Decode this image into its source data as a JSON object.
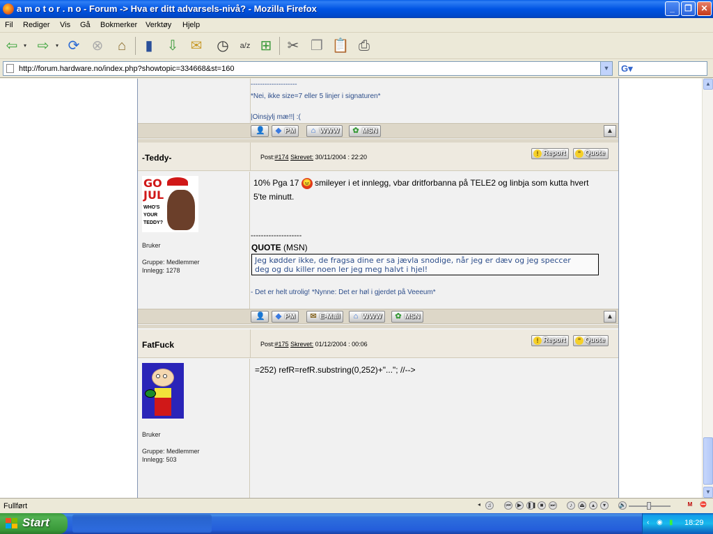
{
  "window": {
    "title": "a m o t o r . n o - Forum -> Hva er ditt advarsels-nivå? - Mozilla Firefox"
  },
  "menu": [
    "Fil",
    "Rediger",
    "Vis",
    "Gå",
    "Bokmerker",
    "Verktøy",
    "Hjelp"
  ],
  "toolbar_icons": [
    "back-icon",
    "back-dropdown-icon",
    "forward-icon",
    "forward-dropdown-icon",
    "reload-icon",
    "stop-icon",
    "home-icon",
    "bookmarks-icon",
    "download-icon",
    "mail-icon",
    "history-icon",
    "translate-icon",
    "new-tab-icon",
    "cut-icon",
    "copy-icon",
    "paste-icon",
    "print-icon"
  ],
  "address": {
    "url": "http://forum.hardware.no/index.php?showtopic=334668&st=160"
  },
  "search": {
    "engine_icon": "google-icon",
    "value": ""
  },
  "prev_post": {
    "sig_divider": "--------------------",
    "sig_line1": "*Nei, ikke size=7 eller 5 linjer i signaturen*",
    "sig_line2": "|Oinsjylj mæ!!| :(",
    "buttons": {
      "pm": "PM",
      "www": "WWW",
      "msn": "MSN"
    }
  },
  "posts": [
    {
      "author": "-Teddy-",
      "post_label": "Post:",
      "post_num": "#174",
      "written_label": "Skrevet:",
      "date": "30/11/2004 : 22:20",
      "report": "Report",
      "quote": "Quote",
      "avatar_text": [
        "GO",
        "JUL",
        "WHO'S",
        "YOUR",
        "TEDDY?"
      ],
      "rank": "Bruker",
      "group": "Gruppe: Medlemmer",
      "posts_count": "Innlegg: 1278",
      "text_before": "10% Pga 17",
      "text_after": "smileyer i et innlegg, vbar dritforbanna på TELE2 og linbja som kutta hvert",
      "text_line2": "5'te minutt.",
      "sig_divider": "--------------------",
      "quote_label": "QUOTE",
      "quote_source": "(MSN)",
      "quote_text1": "Jeg kødder ikke, de fragsa dine er sa jævla snodige, når jeg er dæv og jeg speccer",
      "quote_text2": "deg og du killer noen ler jeg meg halvt i hjel!",
      "sig_line": "- Det er helt utrolig! *Nynne: Det er høl i gjerdet på Veeeum*",
      "buttons": {
        "pm": "PM",
        "email": "E-Mail",
        "www": "WWW",
        "msn": "MSN"
      }
    },
    {
      "author": "FatFuck",
      "post_label": "Post:",
      "post_num": "#175",
      "written_label": "Skrevet:",
      "date": "01/12/2004 : 00:06",
      "report": "Report",
      "quote": "Quote",
      "rank": "Bruker",
      "group": "Gruppe: Medlemmer",
      "posts_count": "Innlegg: 503",
      "text": "=252) refR=refR.substring(0,252)+\"...\"; //-->"
    }
  ],
  "status": {
    "text": "Fullført"
  },
  "taskbar": {
    "start": "Start",
    "clock": "18:29"
  },
  "colors": {
    "titlebar": "#0054e3",
    "post_header": "#eeeae0",
    "button_row": "#ddd7c8",
    "start_green": "#3c9a3c"
  }
}
